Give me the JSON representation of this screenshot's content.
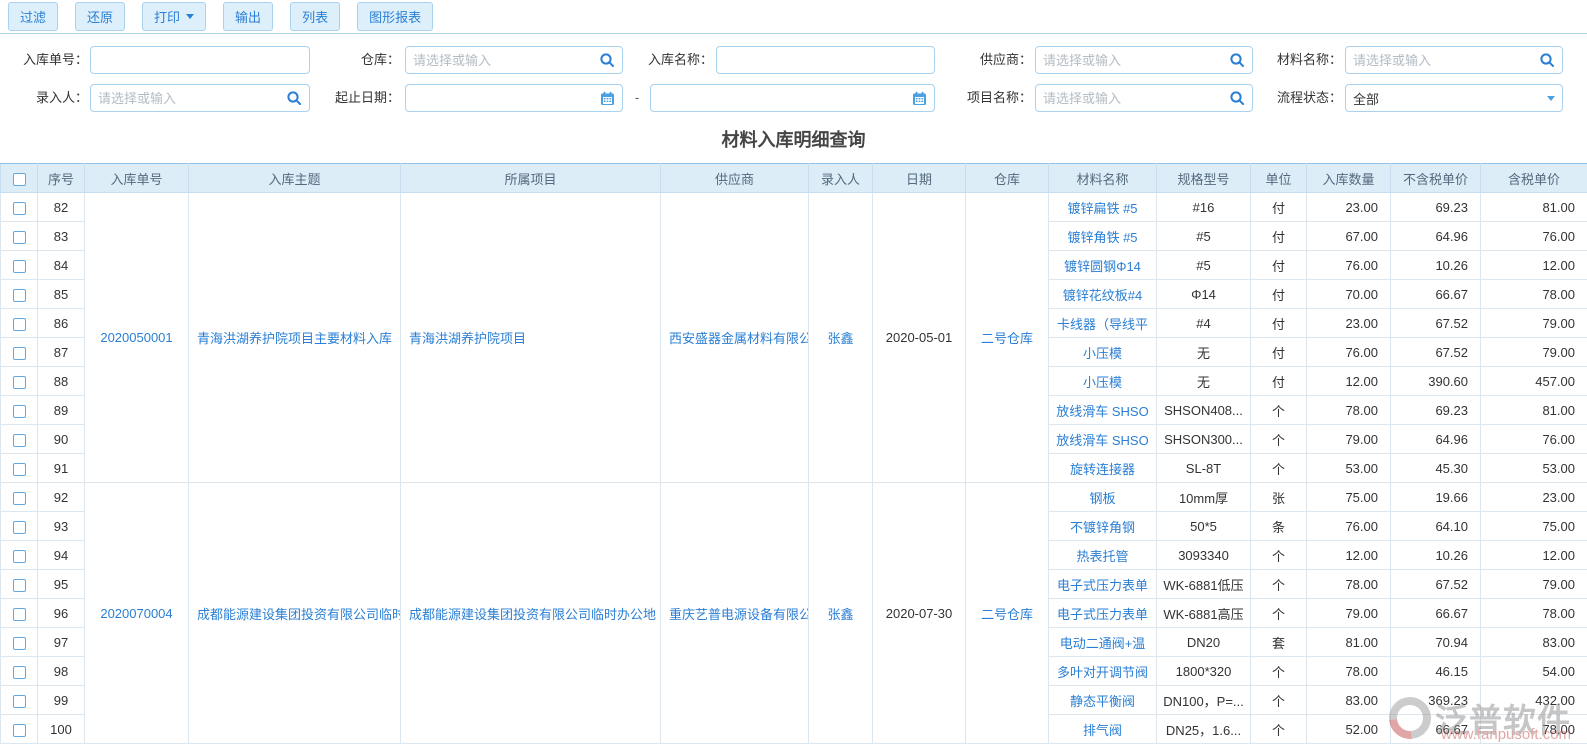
{
  "toolbar": {
    "buttons": [
      {
        "label": "过滤"
      },
      {
        "label": "还原"
      },
      {
        "label": "打印",
        "dropdown": true
      },
      {
        "label": "输出"
      },
      {
        "label": "列表"
      },
      {
        "label": "图形报表"
      }
    ]
  },
  "filters": {
    "range_separator": "-",
    "fields": [
      {
        "label": "入库单号：",
        "placeholder": ""
      },
      {
        "label": "仓库：",
        "placeholder": "请选择或输入"
      },
      {
        "label": "入库名称：",
        "placeholder": ""
      },
      {
        "label": "供应商：",
        "placeholder": "请选择或输入"
      },
      {
        "label": "材料名称：",
        "placeholder": "请选择或输入"
      },
      {
        "label": "录入人：",
        "placeholder": "请选择或输入"
      },
      {
        "label": "起止日期：",
        "placeholder": ""
      },
      {
        "label": "项目名称：",
        "placeholder": "请选择或输入"
      },
      {
        "label": "流程状态：",
        "value": "全部"
      }
    ]
  },
  "title": "材料入库明细查询",
  "table": {
    "columns": [
      "",
      "序号",
      "入库单号",
      "入库主题",
      "所属项目",
      "供应商",
      "录入人",
      "日期",
      "仓库",
      "材料名称",
      "规格型号",
      "单位",
      "入库数量",
      "不含税单价",
      "含税单价"
    ],
    "groups": [
      {
        "order_no": "2020050001",
        "subject": "青海洪湖养护院项目主要材料入库",
        "project": "青海洪湖养护院项目",
        "supplier": "西安盛器金属材料有限公司",
        "recorder": "张鑫",
        "date": "2020-05-01",
        "warehouse": "二号仓库",
        "items": [
          {
            "seq": "82",
            "material": "镀锌扁铁 #5",
            "spec": "#16",
            "unit": "付",
            "qty": "23.00",
            "price_ex": "69.23",
            "price_inc": "81.00"
          },
          {
            "seq": "83",
            "material": "镀锌角铁 #5",
            "spec": "#5",
            "unit": "付",
            "qty": "67.00",
            "price_ex": "64.96",
            "price_inc": "76.00"
          },
          {
            "seq": "84",
            "material": "镀锌圆钢Φ14",
            "spec": "#5",
            "unit": "付",
            "qty": "76.00",
            "price_ex": "10.26",
            "price_inc": "12.00"
          },
          {
            "seq": "85",
            "material": "镀锌花纹板#4",
            "spec": "Φ14",
            "unit": "付",
            "qty": "70.00",
            "price_ex": "66.67",
            "price_inc": "78.00"
          },
          {
            "seq": "86",
            "material": "卡线器（导线平",
            "spec": "#4",
            "unit": "付",
            "qty": "23.00",
            "price_ex": "67.52",
            "price_inc": "79.00"
          },
          {
            "seq": "87",
            "material": "小压模",
            "spec": "无",
            "unit": "付",
            "qty": "76.00",
            "price_ex": "67.52",
            "price_inc": "79.00"
          },
          {
            "seq": "88",
            "material": "小压模",
            "spec": "无",
            "unit": "付",
            "qty": "12.00",
            "price_ex": "390.60",
            "price_inc": "457.00"
          },
          {
            "seq": "89",
            "material": "放线滑车 SHSO",
            "spec": "SHSON408...",
            "unit": "个",
            "qty": "78.00",
            "price_ex": "69.23",
            "price_inc": "81.00"
          },
          {
            "seq": "90",
            "material": "放线滑车 SHSO",
            "spec": "SHSON300...",
            "unit": "个",
            "qty": "79.00",
            "price_ex": "64.96",
            "price_inc": "76.00"
          },
          {
            "seq": "91",
            "material": "旋转连接器",
            "spec": "SL-8T",
            "unit": "个",
            "qty": "53.00",
            "price_ex": "45.30",
            "price_inc": "53.00"
          }
        ]
      },
      {
        "order_no": "2020070004",
        "subject": "成都能源建设集团投资有限公司临时",
        "project": "成都能源建设集团投资有限公司临时办公地",
        "supplier": "重庆艺普电源设备有限公司",
        "recorder": "张鑫",
        "date": "2020-07-30",
        "warehouse": "二号仓库",
        "items": [
          {
            "seq": "92",
            "material": "钢板",
            "spec": "10mm厚",
            "unit": "张",
            "qty": "75.00",
            "price_ex": "19.66",
            "price_inc": "23.00"
          },
          {
            "seq": "93",
            "material": "不镀锌角钢",
            "spec": "50*5",
            "unit": "条",
            "qty": "76.00",
            "price_ex": "64.10",
            "price_inc": "75.00"
          },
          {
            "seq": "94",
            "material": "热表托管",
            "spec": "3093340",
            "unit": "个",
            "qty": "12.00",
            "price_ex": "10.26",
            "price_inc": "12.00"
          },
          {
            "seq": "95",
            "material": "电子式压力表单",
            "spec": "WK-6881低压",
            "unit": "个",
            "qty": "78.00",
            "price_ex": "67.52",
            "price_inc": "79.00"
          },
          {
            "seq": "96",
            "material": "电子式压力表单",
            "spec": "WK-6881高压",
            "unit": "个",
            "qty": "79.00",
            "price_ex": "66.67",
            "price_inc": "78.00"
          },
          {
            "seq": "97",
            "material": "电动二通阀+温",
            "spec": "DN20",
            "unit": "套",
            "qty": "81.00",
            "price_ex": "70.94",
            "price_inc": "83.00"
          },
          {
            "seq": "98",
            "material": "多叶对开调节阀",
            "spec": "1800*320",
            "unit": "个",
            "qty": "78.00",
            "price_ex": "46.15",
            "price_inc": "54.00"
          },
          {
            "seq": "99",
            "material": "静态平衡阀",
            "spec": "DN100，P=...",
            "unit": "个",
            "qty": "83.00",
            "price_ex": "369.23",
            "price_inc": "432.00"
          },
          {
            "seq": "100",
            "material": "排气阀",
            "spec": "DN25，1.6...",
            "unit": "个",
            "qty": "52.00",
            "price_ex": "66.67",
            "price_inc": "78.00"
          }
        ]
      }
    ]
  },
  "watermark": {
    "brand": "泛普软件",
    "url_text": "www.fanpusoft.com"
  },
  "colors": {
    "link": "#2a7fd4",
    "header_bg": "#dcedf8",
    "button_bg": "#ddeffb",
    "button_border": "#a9d2ef",
    "table_border": "#dce6ee",
    "title_text": "#454545",
    "watermark_red": "#c0504d"
  }
}
